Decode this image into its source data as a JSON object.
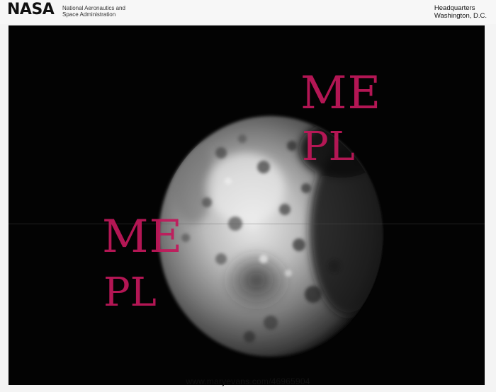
{
  "header": {
    "logo_text": "NASA",
    "agency_line1": "National Aeronautics and",
    "agency_line2": "Space Administration",
    "hq_line1": "Headquarters",
    "hq_line2": "Washington, D.C."
  },
  "watermark": {
    "line1": "ME",
    "line2": "PL",
    "color": "#c2185b"
  },
  "footer": {
    "url": "www.maryevans.com/46965904"
  }
}
